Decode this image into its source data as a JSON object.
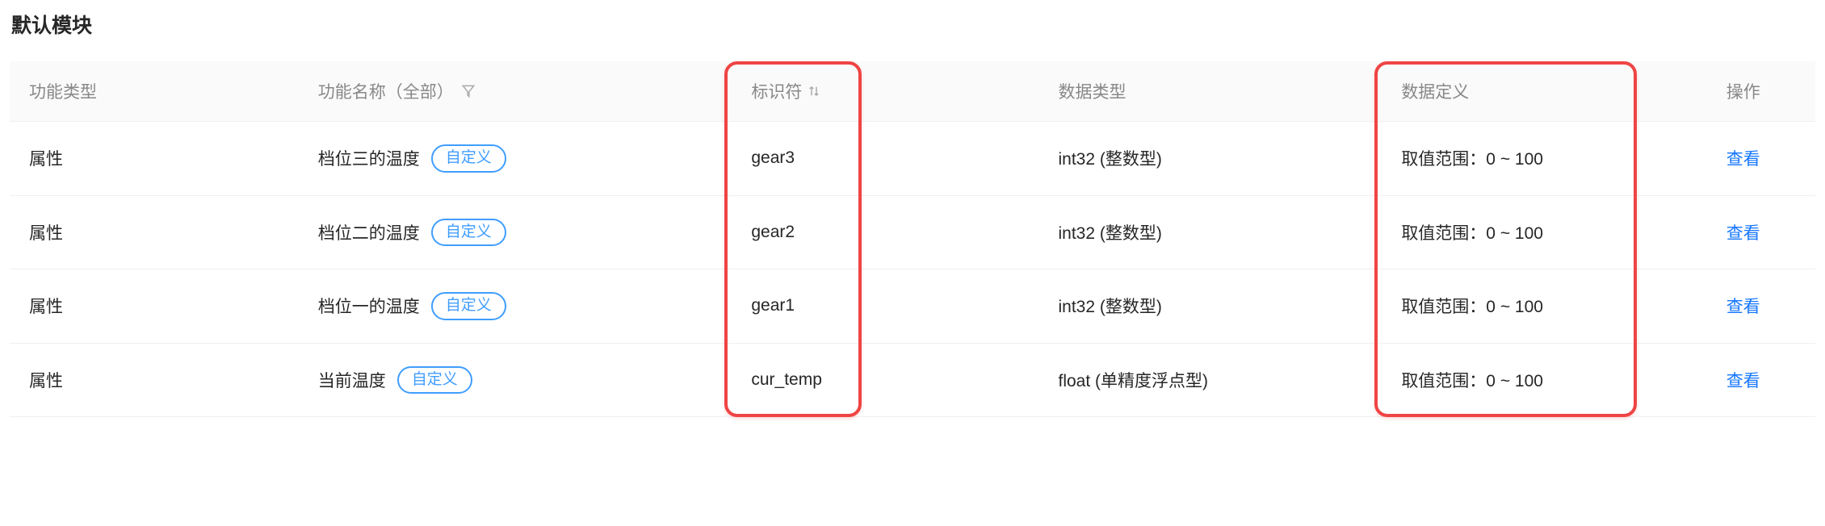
{
  "section_title": "默认模块",
  "table": {
    "headers": {
      "type": "功能类型",
      "name": "功能名称（全部）",
      "identifier": "标识符",
      "datatype": "数据类型",
      "definition": "数据定义",
      "actions": "操作"
    },
    "custom_badge_label": "自定义",
    "action_view_label": "查看",
    "rows": [
      {
        "type": "属性",
        "name": "档位三的温度",
        "identifier": "gear3",
        "datatype": "int32 (整数型)",
        "definition": "取值范围：0 ~ 100"
      },
      {
        "type": "属性",
        "name": "档位二的温度",
        "identifier": "gear2",
        "datatype": "int32 (整数型)",
        "definition": "取值范围：0 ~ 100"
      },
      {
        "type": "属性",
        "name": "档位一的温度",
        "identifier": "gear1",
        "datatype": "int32 (整数型)",
        "definition": "取值范围：0 ~ 100"
      },
      {
        "type": "属性",
        "name": "当前温度",
        "identifier": "cur_temp",
        "datatype": "float (单精度浮点型)",
        "definition": "取值范围：0 ~ 100"
      }
    ]
  }
}
